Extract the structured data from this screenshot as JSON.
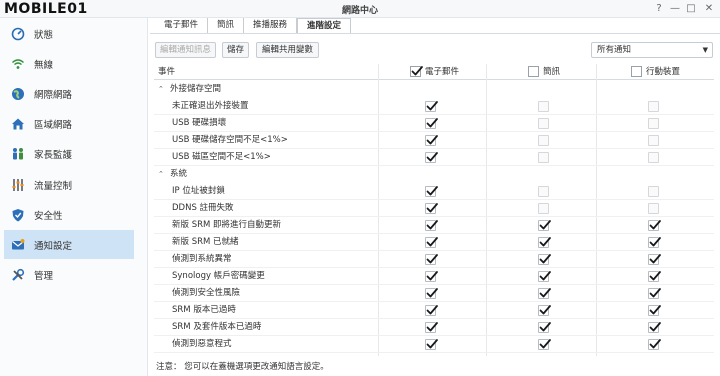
{
  "logo_text": "MOBILE01",
  "window": {
    "title": "網路中心",
    "help": "?",
    "minimize": "—",
    "maximize": "□",
    "close": "✕"
  },
  "sidebar": {
    "items": [
      {
        "label": "狀態",
        "icon": "dashboard-icon"
      },
      {
        "label": "無線",
        "icon": "wifi-icon"
      },
      {
        "label": "網際網路",
        "icon": "globe-icon"
      },
      {
        "label": "區域網路",
        "icon": "home-network-icon"
      },
      {
        "label": "家長監護",
        "icon": "family-icon"
      },
      {
        "label": "流量控制",
        "icon": "sliders-icon"
      },
      {
        "label": "安全性",
        "icon": "shield-icon"
      },
      {
        "label": "通知設定",
        "icon": "notification-icon"
      },
      {
        "label": "管理",
        "icon": "tools-icon"
      }
    ],
    "active_index": 7
  },
  "tabs": [
    "電子郵件",
    "簡訊",
    "推播服務",
    "進階設定"
  ],
  "active_tab": 3,
  "toolbar": {
    "edit_message": "編輯通知訊息",
    "save": "儲存",
    "edit_vars": "編輯共用變數",
    "filter_value": "所有通知",
    "filter_caret": "▼"
  },
  "table": {
    "headers": {
      "event": "事件",
      "email": "電子郵件",
      "sms": "簡訊",
      "mobile": "行動裝置"
    },
    "header_checks": {
      "email": true,
      "sms": false,
      "mobile": false
    },
    "groups": [
      {
        "name": "外接儲存空間",
        "rows": [
          {
            "label": "未正確退出外接裝置",
            "email": true,
            "sms": false,
            "mobile": false
          },
          {
            "label": "USB 硬碟損壞",
            "email": true,
            "sms": false,
            "mobile": false
          },
          {
            "label": "USB 硬碟儲存空間不足<1%>",
            "email": true,
            "sms": false,
            "mobile": false
          },
          {
            "label": "USB 磁區空間不足<1%>",
            "email": true,
            "sms": false,
            "mobile": false
          }
        ]
      },
      {
        "name": "系統",
        "rows": [
          {
            "label": "IP 位址被封鎖",
            "email": true,
            "sms": false,
            "mobile": false
          },
          {
            "label": "DDNS 註冊失敗",
            "email": true,
            "sms": false,
            "mobile": false
          },
          {
            "label": "新版 SRM 即將進行自動更新",
            "email": true,
            "sms": true,
            "mobile": true
          },
          {
            "label": "新版 SRM 已就緒",
            "email": true,
            "sms": true,
            "mobile": true
          },
          {
            "label": "偵測到系統異常",
            "email": true,
            "sms": true,
            "mobile": true
          },
          {
            "label": "Synology 帳戶密碼變更",
            "email": true,
            "sms": true,
            "mobile": true
          },
          {
            "label": "偵測到安全性風險",
            "email": true,
            "sms": true,
            "mobile": true
          },
          {
            "label": "SRM 版本已過時",
            "email": true,
            "sms": true,
            "mobile": true
          },
          {
            "label": "SRM 及套件版本已過時",
            "email": true,
            "sms": true,
            "mobile": true
          },
          {
            "label": "偵測到惡意程式",
            "email": true,
            "sms": true,
            "mobile": true
          }
        ]
      }
    ]
  },
  "note": "注意： 您可以在蓋機選項更改通知語言設定。",
  "colors": {
    "active_sidebar": "#cfe3f6",
    "check": "#1a1a1a"
  }
}
